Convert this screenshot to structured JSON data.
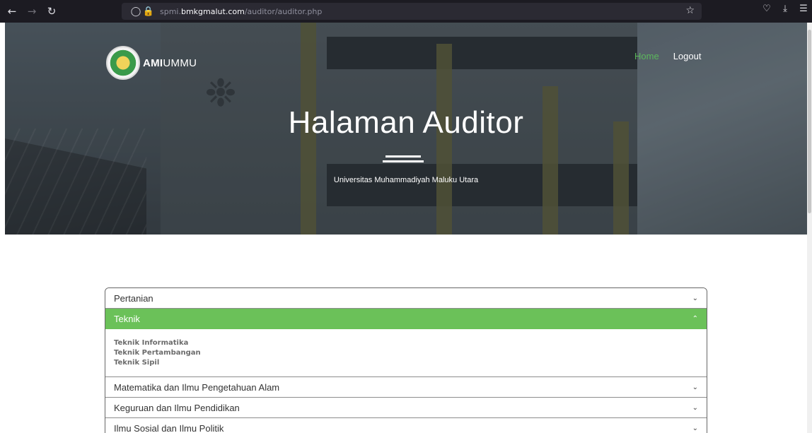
{
  "browser": {
    "url_prefix": "spmi.",
    "url_domain": "bmkgmalut.com",
    "url_path": "/auditor/auditor.php"
  },
  "icons": {
    "back": "arrow-left-icon",
    "forward": "arrow-right-icon",
    "reload": "reload-icon",
    "shield": "shield-icon",
    "lock": "lock-icon",
    "bookmark": "star-icon",
    "pocket": "pocket-icon",
    "downloads": "download-icon",
    "menu": "hamburger-menu-icon"
  },
  "brand": {
    "bold": "AMI",
    "regular": "UMMU"
  },
  "nav": {
    "home": "Home",
    "logout": "Logout"
  },
  "hero": {
    "title": "Halaman Auditor",
    "subtitle": "Universitas Muhammadiyah Maluku Utara"
  },
  "accordion": {
    "items": [
      {
        "label": "Pertanian",
        "expanded": false
      },
      {
        "label": "Teknik",
        "expanded": true,
        "children": [
          "Teknik Informatika",
          "Teknik Pertambangan",
          "Teknik Sipil"
        ]
      },
      {
        "label": "Matematika dan Ilmu Pengetahuan Alam",
        "expanded": false
      },
      {
        "label": "Keguruan dan Ilmu Pendidikan",
        "expanded": false
      },
      {
        "label": "Ilmu Sosial dan Ilmu Politik",
        "expanded": false
      }
    ]
  },
  "colors": {
    "accent_green": "#6bc159",
    "nav_home": "#5cb85c",
    "browser_chrome": "#1c1b22"
  }
}
